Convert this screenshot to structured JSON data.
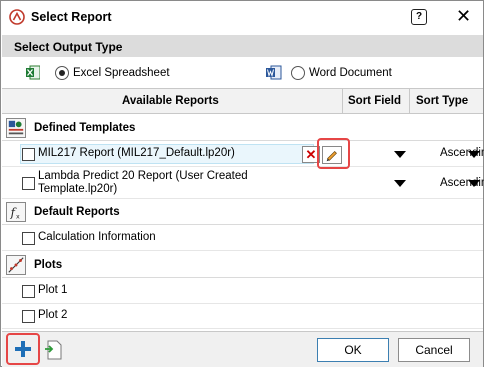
{
  "window": {
    "title": "Select Report"
  },
  "output_type": {
    "header": "Select Output Type",
    "options": [
      {
        "label": "Excel Spreadsheet",
        "selected": true,
        "icon": "excel-icon"
      },
      {
        "label": "Word Document",
        "selected": false,
        "icon": "word-icon"
      }
    ]
  },
  "grid": {
    "columns": [
      "Available Reports",
      "Sort Field",
      "Sort Type"
    ],
    "categories": [
      {
        "label": "Defined Templates",
        "icon": "templates-icon",
        "items": [
          {
            "label": "MIL217 Report (MIL217_Default.lp20r)",
            "checked": false,
            "selected": true,
            "sort_type": "Ascending"
          },
          {
            "label": "Lambda Predict 20 Report (User Created Template.lp20r)",
            "label_line1": "Lambda Predict 20 Report (User Created",
            "label_line2": "Template.lp20r)",
            "checked": false,
            "sort_type": "Ascending"
          }
        ]
      },
      {
        "label": "Default Reports",
        "icon": "function-icon",
        "items": [
          {
            "label": "Calculation Information",
            "checked": false
          }
        ]
      },
      {
        "label": "Plots",
        "icon": "plot-icon",
        "items": [
          {
            "label": "Plot 1",
            "checked": false
          },
          {
            "label": "Plot 2",
            "checked": false
          }
        ]
      }
    ]
  },
  "footer": {
    "ok_label": "OK",
    "cancel_label": "Cancel"
  },
  "colors": {
    "highlight": "#e64646",
    "selected_row": "#eaf6fc",
    "add_icon": "#1f6fb7"
  }
}
